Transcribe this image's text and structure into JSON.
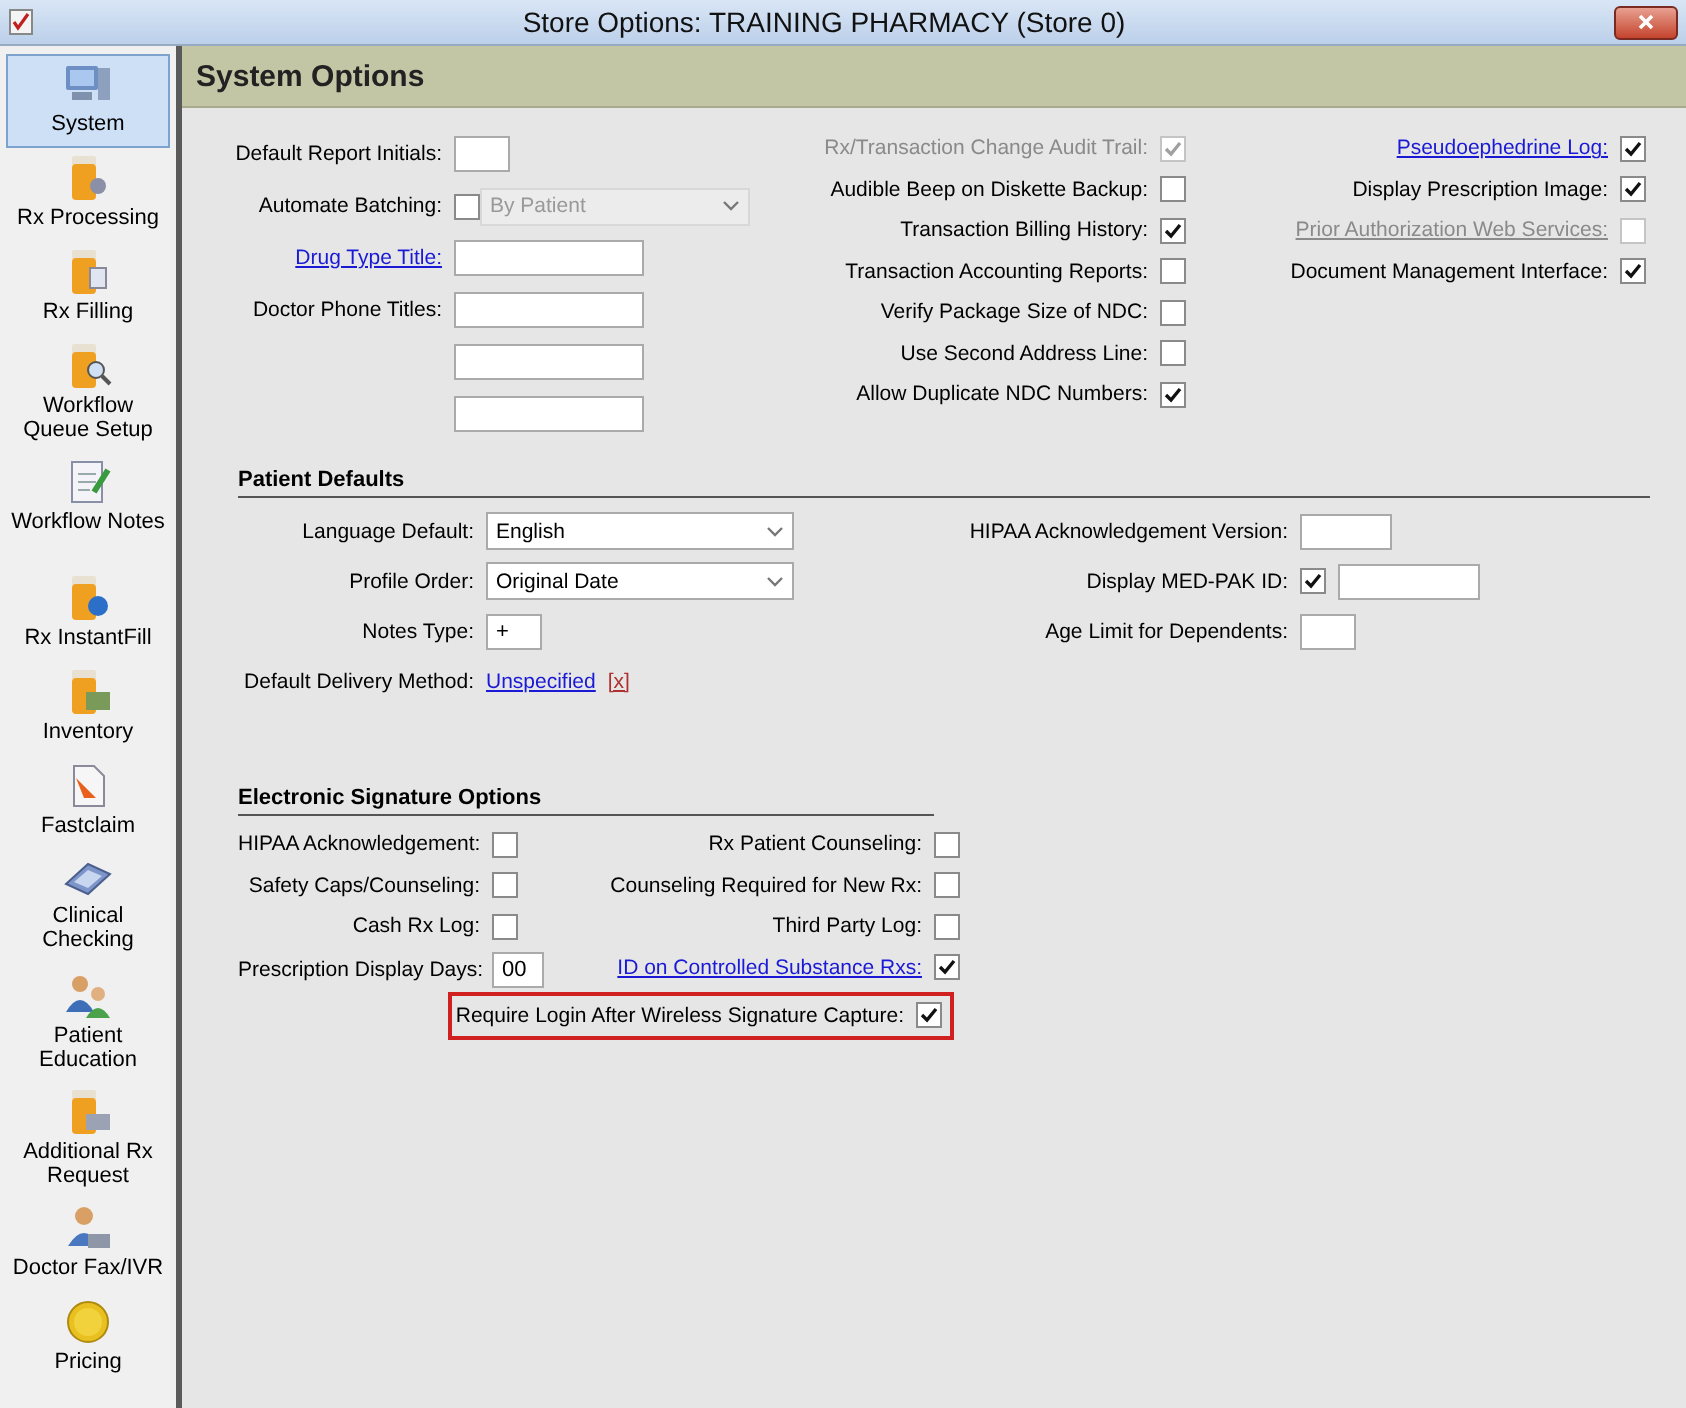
{
  "window": {
    "title": "Store Options: TRAINING PHARMACY (Store 0)"
  },
  "sidebar": {
    "items": [
      {
        "label": "System",
        "selected": true
      },
      {
        "label": "Rx Processing",
        "selected": false
      },
      {
        "label": "Rx Filling",
        "selected": false
      },
      {
        "label": "Workflow Queue Setup",
        "selected": false
      },
      {
        "label": "Workflow Notes",
        "selected": false
      },
      {
        "label": "Rx InstantFill",
        "selected": false
      },
      {
        "label": "Inventory",
        "selected": false
      },
      {
        "label": "Fastclaim",
        "selected": false
      },
      {
        "label": "Clinical Checking",
        "selected": false
      },
      {
        "label": "Patient Education",
        "selected": false
      },
      {
        "label": "Additional Rx Request",
        "selected": false
      },
      {
        "label": "Doctor Fax/IVR",
        "selected": false
      },
      {
        "label": "Pricing",
        "selected": false
      }
    ]
  },
  "header": {
    "title": "System Options"
  },
  "system_options": {
    "fields": [
      {
        "kind": "short_field",
        "label": "Default Report Initials:",
        "link": false
      },
      {
        "kind": "checkbox_select",
        "label": "Automate Batching:",
        "link": false,
        "checked": false,
        "select_value": "By Patient",
        "select_disabled": true
      },
      {
        "kind": "field",
        "label": "Drug Type Title:",
        "link": true
      },
      {
        "kind": "field",
        "label": "Doctor Phone Titles:",
        "link": false
      },
      {
        "kind": "field"
      },
      {
        "kind": "field"
      }
    ],
    "checks": [
      {
        "label": "Rx/Transaction Change Audit Trail:",
        "checked": true,
        "disabled": true,
        "link": false
      },
      {
        "label": "Audible Beep on Diskette Backup:",
        "checked": false,
        "disabled": false,
        "link": false
      },
      {
        "label": "Transaction Billing History:",
        "checked": true,
        "disabled": false,
        "link": false
      },
      {
        "label": "Transaction Accounting Reports:",
        "checked": false,
        "disabled": false,
        "link": false
      },
      {
        "label": "Verify Package Size of NDC:",
        "checked": false,
        "disabled": false,
        "link": false
      },
      {
        "label": "Use Second Address Line:",
        "checked": false,
        "disabled": false,
        "link": false
      },
      {
        "label": "Allow Duplicate NDC Numbers:",
        "checked": true,
        "disabled": false,
        "link": false
      }
    ],
    "extra_checks": [
      {
        "label": "Pseudoephedrine Log:",
        "checked": true,
        "disabled": false,
        "link": true
      },
      {
        "label": "Display Prescription Image:",
        "checked": true,
        "disabled": false,
        "link": false
      },
      {
        "label": "Prior Authorization Web Services:",
        "checked": false,
        "disabled": true,
        "link": true
      },
      {
        "label": "Document Management Interface:",
        "checked": true,
        "disabled": false,
        "link": false
      }
    ]
  },
  "patient_defaults": {
    "title": "Patient Defaults",
    "left": [
      {
        "kind": "select",
        "label": "Language Default:",
        "value": "English"
      },
      {
        "kind": "select",
        "label": "Profile Order:",
        "value": "Original Date"
      },
      {
        "kind": "short_field",
        "label": "Notes Type:",
        "value": "+"
      },
      {
        "kind": "link_clear",
        "label": "Default Delivery Method:",
        "value": "Unspecified",
        "clear": "[x]"
      }
    ],
    "right": [
      {
        "kind": "medium_field",
        "label": "HIPAA Acknowledgement Version:"
      },
      {
        "kind": "checkbox_field",
        "label": "Display MED-PAK ID:",
        "checked": true
      },
      {
        "kind": "short_field",
        "label": "Age Limit for Dependents:"
      }
    ]
  },
  "esignature": {
    "title": "Electronic Signature Options",
    "left": [
      {
        "kind": "checkbox",
        "label": "HIPAA Acknowledgement:",
        "checked": false,
        "link": false
      },
      {
        "kind": "checkbox",
        "label": "Safety Caps/Counseling:",
        "checked": false,
        "link": false
      },
      {
        "kind": "checkbox",
        "label": "Cash Rx Log:",
        "checked": false,
        "link": false
      },
      {
        "kind": "short_field",
        "label": "Prescription Display Days:",
        "value": "00"
      }
    ],
    "right": [
      {
        "kind": "checkbox",
        "label": "Rx Patient Counseling:",
        "checked": false,
        "link": false
      },
      {
        "kind": "checkbox",
        "label": "Counseling Required for New Rx:",
        "checked": false,
        "link": false
      },
      {
        "kind": "checkbox",
        "label": "Third Party Log:",
        "checked": false,
        "link": false
      },
      {
        "kind": "checkbox",
        "label": "ID on Controlled Substance Rxs:",
        "checked": true,
        "link": true
      }
    ],
    "bottom": {
      "label": "Require Login After Wireless Signature Capture:",
      "checked": true,
      "highlighted": true
    }
  }
}
